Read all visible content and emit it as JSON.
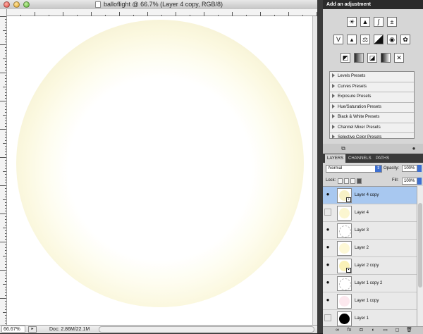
{
  "document": {
    "title": "balloflight @ 66.7% (Layer 4 copy, RGB/8)",
    "zoom": "66.67%",
    "doc_size": "Doc: 2.86M/22.1M"
  },
  "adjustments": {
    "header": "Add an adjustment",
    "icons_row1": [
      "brightness-contrast-icon",
      "levels-icon",
      "curves-icon",
      "exposure-icon"
    ],
    "icons_row2": [
      "vibrance-icon",
      "hue-saturation-icon",
      "color-balance-icon",
      "black-white-icon",
      "photo-filter-icon",
      "channel-mixer-icon"
    ],
    "icons_row3": [
      "invert-icon",
      "posterize-icon",
      "threshold-icon",
      "gradient-map-icon",
      "selective-color-icon"
    ],
    "presets": [
      "Levels Presets",
      "Curves Presets",
      "Exposure Presets",
      "Hue/Saturation Presets",
      "Black & White Presets",
      "Channel Mixer Presets",
      "Selective Color Presets"
    ]
  },
  "layers_panel": {
    "tabs": [
      "LAYERS",
      "CHANNELS",
      "PATHS"
    ],
    "blend_mode": "Normal",
    "opacity_label": "Opacity:",
    "opacity_value": "100%",
    "lock_label": "Lock:",
    "fill_label": "Fill:",
    "fill_value": "100%",
    "layers": [
      {
        "name": "Layer 4 copy",
        "selected": true,
        "visible": true,
        "smart": true,
        "thumb": "#f7f1c6"
      },
      {
        "name": "Layer 4",
        "selected": false,
        "visible": false,
        "smart": false,
        "thumb": "#fbf6d0"
      },
      {
        "name": "Layer 3",
        "selected": false,
        "visible": true,
        "smart": false,
        "thumb": "#ffffff"
      },
      {
        "name": "Layer 2",
        "selected": false,
        "visible": true,
        "smart": false,
        "thumb": "#fdf8d6"
      },
      {
        "name": "Layer 2 copy",
        "selected": false,
        "visible": true,
        "smart": true,
        "thumb": "#faf1b8"
      },
      {
        "name": "Layer 1 copy 2",
        "selected": false,
        "visible": true,
        "smart": false,
        "thumb": "#ffffff"
      },
      {
        "name": "Layer 1 copy",
        "selected": false,
        "visible": true,
        "smart": false,
        "thumb": "#fce8ee"
      },
      {
        "name": "Layer 1",
        "selected": false,
        "visible": false,
        "smart": false,
        "thumb": "#000000"
      }
    ]
  },
  "colors": {
    "accent_blue": "#3d6fd1",
    "selection_blue": "#a8c8f0",
    "balloon_edge": "#ddd7b8"
  }
}
